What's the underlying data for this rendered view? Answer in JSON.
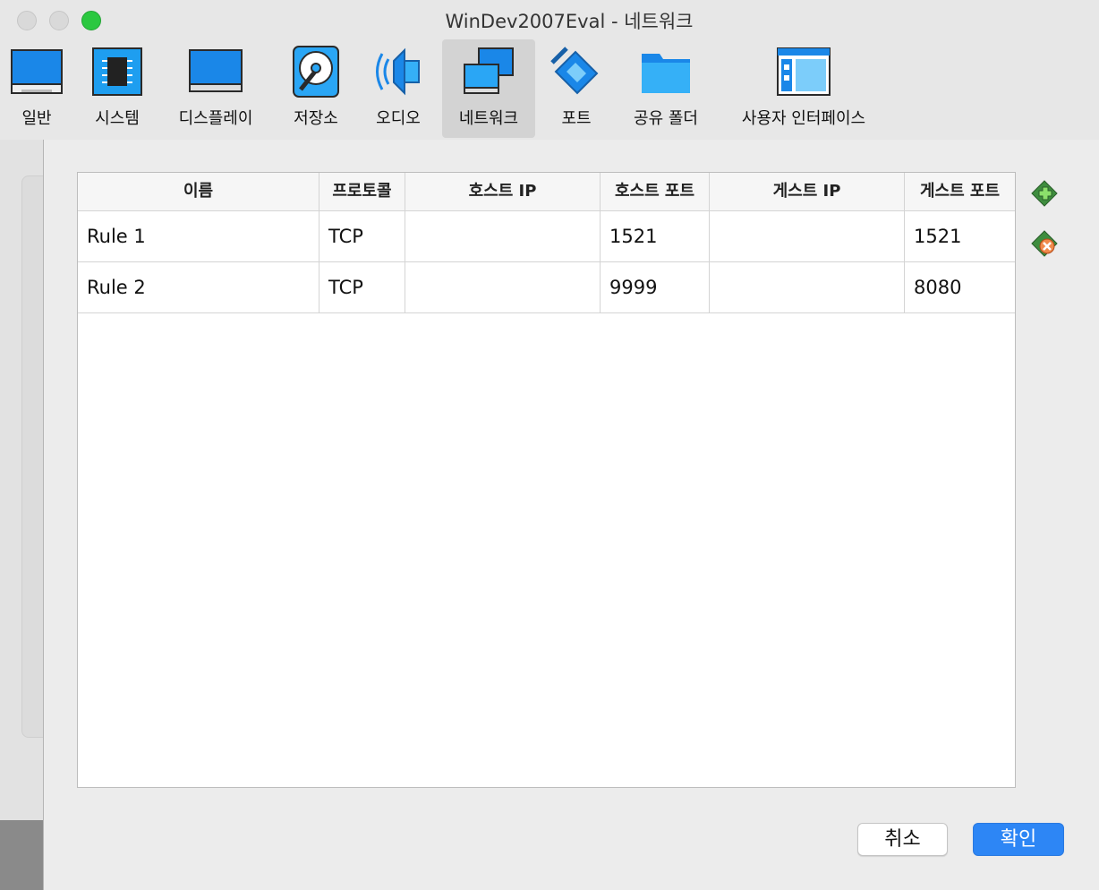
{
  "window": {
    "title": "WinDev2007Eval - 네트워크"
  },
  "toolbar": {
    "items": [
      {
        "label": "일반",
        "icon": "general-monitor-icon"
      },
      {
        "label": "시스템",
        "icon": "system-chip-icon"
      },
      {
        "label": "디스플레이",
        "icon": "display-monitor-icon"
      },
      {
        "label": "저장소",
        "icon": "storage-disk-icon"
      },
      {
        "label": "오디오",
        "icon": "audio-speaker-icon"
      },
      {
        "label": "네트워크",
        "icon": "network-monitors-icon",
        "selected": true
      },
      {
        "label": "포트",
        "icon": "ports-serial-icon"
      },
      {
        "label": "공유 폴더",
        "icon": "shared-folder-icon"
      },
      {
        "label": "사용자 인터페이스",
        "icon": "user-interface-window-icon"
      }
    ]
  },
  "table": {
    "columns": [
      "이름",
      "프로토콜",
      "호스트 IP",
      "호스트 포트",
      "게스트 IP",
      "게스트 포트"
    ],
    "rows": [
      [
        "Rule 1",
        "TCP",
        "",
        "1521",
        "",
        "1521"
      ],
      [
        "Rule 2",
        "TCP",
        "",
        "9999",
        "",
        "8080"
      ]
    ]
  },
  "side_actions": {
    "add_icon": "add-rule-icon",
    "remove_icon": "remove-rule-icon"
  },
  "buttons": {
    "cancel": "취소",
    "ok": "확인"
  },
  "colors": {
    "accent": "#2d86f5",
    "zoom": "#2bc840"
  }
}
